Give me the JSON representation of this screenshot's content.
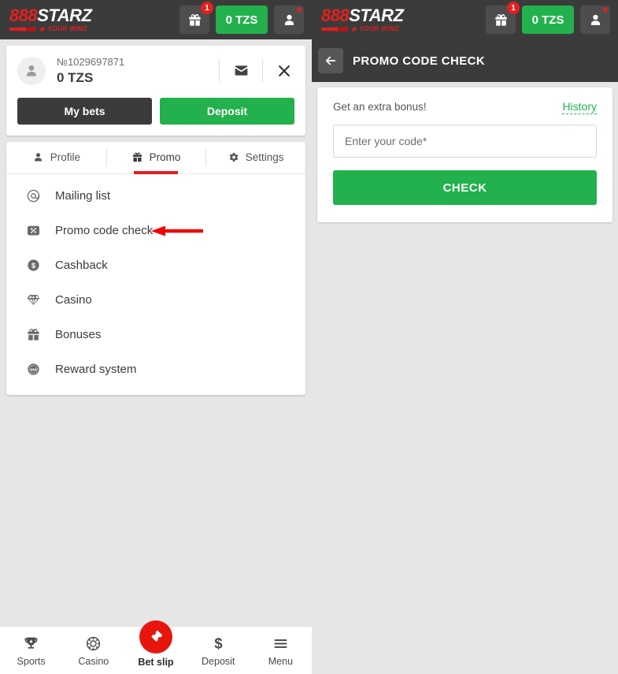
{
  "brand": {
    "logo_888": "888",
    "logo_starz": "STARZ",
    "tagline": "YOUR WINZ"
  },
  "colors": {
    "accent_red": "#e41f1f",
    "accent_green": "#22b14c",
    "header_dark": "#3b3b3b",
    "page_bg": "#e6e6e6",
    "betslip_red": "#e8150f"
  },
  "header": {
    "gift_badge": "1",
    "balance": "0 TZS"
  },
  "profile": {
    "account_id": "№1029697871",
    "balance": "0 TZS",
    "my_bets_label": "My bets",
    "deposit_label": "Deposit"
  },
  "tabs": [
    {
      "label": "Profile",
      "icon": "person-icon",
      "active": false
    },
    {
      "label": "Promo",
      "icon": "gift-icon",
      "active": true
    },
    {
      "label": "Settings",
      "icon": "gear-icon",
      "active": false
    }
  ],
  "promo_menu": [
    {
      "label": "Mailing list",
      "icon": "at-icon",
      "annotated": false
    },
    {
      "label": "Promo code check",
      "icon": "percent-badge-icon",
      "annotated": true
    },
    {
      "label": "Cashback",
      "icon": "dollar-coin-icon",
      "annotated": false
    },
    {
      "label": "Casino",
      "icon": "diamond-icon",
      "annotated": false
    },
    {
      "label": "Bonuses",
      "icon": "gift-icon",
      "annotated": false
    },
    {
      "label": "Reward system",
      "icon": "reward-coin-icon",
      "annotated": false
    }
  ],
  "right_panel": {
    "title": "PROMO CODE CHECK",
    "bonus_label": "Get an extra bonus!",
    "history_label": "History",
    "code_placeholder": "Enter your code*",
    "code_value": "",
    "check_label": "CHECK"
  },
  "bottom_nav": [
    {
      "label": "Sports",
      "icon": "trophy-icon"
    },
    {
      "label": "Casino",
      "icon": "chip-icon"
    },
    {
      "label": "Bet slip",
      "icon": "ticket-icon"
    },
    {
      "label": "Deposit",
      "icon": "dollar-icon"
    },
    {
      "label": "Menu",
      "icon": "hamburger-icon"
    }
  ]
}
